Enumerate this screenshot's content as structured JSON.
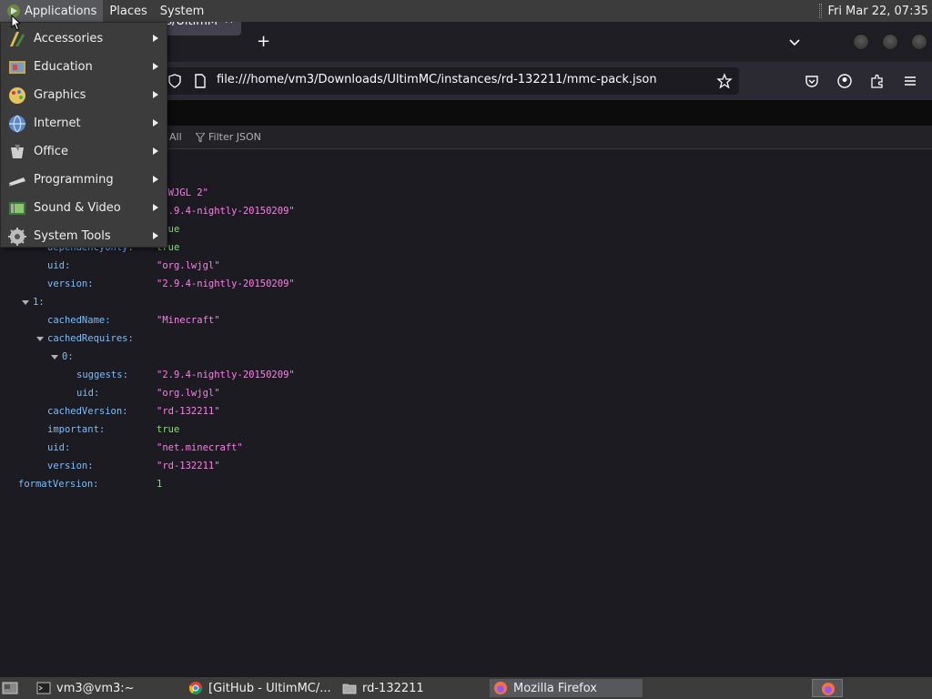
{
  "top_panel": {
    "menus": [
      "Applications",
      "Places",
      "System"
    ],
    "clock": "Fri Mar 22, 07:35"
  },
  "firefox": {
    "tab": {
      "title": "ds/UltimM",
      "close_glyph": "✕"
    },
    "new_tab_glyph": "+",
    "url": "file:///home/vm3/Downloads/UltimMC/instances/rd-132211/mmc-pack.json",
    "json_toolbar": {
      "collapse_all": "All",
      "filter_placeholder": "Filter JSON"
    }
  },
  "app_menu": {
    "items": [
      {
        "label": "Accessories",
        "icon": "accessories-icon"
      },
      {
        "label": "Education",
        "icon": "education-icon"
      },
      {
        "label": "Graphics",
        "icon": "graphics-icon"
      },
      {
        "label": "Internet",
        "icon": "internet-icon"
      },
      {
        "label": "Office",
        "icon": "office-icon"
      },
      {
        "label": "Programming",
        "icon": "programming-icon"
      },
      {
        "label": "Sound & Video",
        "icon": "sound-video-icon"
      },
      {
        "label": "System Tools",
        "icon": "system-tools-icon"
      }
    ]
  },
  "json_rows": [
    {
      "key": "",
      "value": "\"LWJGL 2\"",
      "kind": "str"
    },
    {
      "key": "",
      "value": "\"2.9.4-nightly-20150209\"",
      "kind": "str"
    },
    {
      "key": "",
      "value": "true",
      "kind": "bool"
    },
    {
      "key": "dependencyOnly:",
      "value": "true",
      "kind": "bool"
    },
    {
      "key": "uid:",
      "value": "\"org.lwjgl\"",
      "kind": "str"
    },
    {
      "key": "version:",
      "value": "\"2.9.4-nightly-20150209\"",
      "kind": "str"
    },
    {
      "key": "1:",
      "value": "",
      "kind": "obj"
    },
    {
      "key": "cachedName:",
      "value": "\"Minecraft\"",
      "kind": "str"
    },
    {
      "key": "cachedRequires:",
      "value": "",
      "kind": "obj"
    },
    {
      "key": "0:",
      "value": "",
      "kind": "obj"
    },
    {
      "key": "suggests:",
      "value": "\"2.9.4-nightly-20150209\"",
      "kind": "str"
    },
    {
      "key": "uid:",
      "value": "\"org.lwjgl\"",
      "kind": "str"
    },
    {
      "key": "cachedVersion:",
      "value": "\"rd-132211\"",
      "kind": "str"
    },
    {
      "key": "important:",
      "value": "true",
      "kind": "bool"
    },
    {
      "key": "uid:",
      "value": "\"net.minecraft\"",
      "kind": "str"
    },
    {
      "key": "version:",
      "value": "\"rd-132211\"",
      "kind": "str"
    },
    {
      "key": "formatVersion:",
      "value": "1",
      "kind": "num"
    }
  ],
  "taskbar": {
    "tasks": [
      {
        "label": "vm3@vm3:~",
        "icon": "terminal-icon"
      },
      {
        "label": "[GitHub - UltimMC/...",
        "icon": "chrome-icon"
      },
      {
        "label": "rd-132211",
        "icon": "folder-icon"
      },
      {
        "label": "Mozilla Firefox",
        "icon": "firefox-icon"
      }
    ]
  },
  "colors": {
    "panel": "#3c3c3c",
    "json_key": "#75bfff",
    "json_string": "#ff7de9",
    "json_literal": "#86de74"
  }
}
